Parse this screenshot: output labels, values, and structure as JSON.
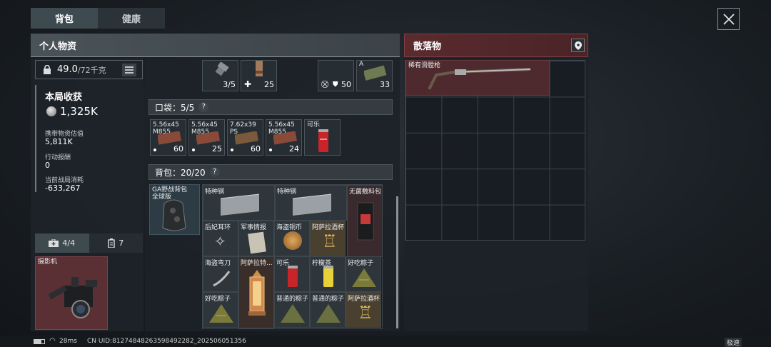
{
  "tabs": [
    {
      "label": "背包",
      "active": true
    },
    {
      "label": "健康",
      "active": false
    }
  ],
  "headers": {
    "personal": "个人物资",
    "loot": "散落物"
  },
  "weight": {
    "current": "49.0",
    "max": "/72千克"
  },
  "stats": {
    "title": "本局收获",
    "earnings": "1,325K",
    "carry_label": "携带物资估值",
    "carry_value": "5,811K",
    "action_label": "行动报酬",
    "action_value": "0",
    "cost_label": "当前战局消耗",
    "cost_value": "-633,267"
  },
  "equip_tabs": {
    "kit": "4/4",
    "ammo": "7"
  },
  "camera": {
    "label": "摄影机"
  },
  "top_items": [
    {
      "label": "",
      "count": "3/5"
    },
    {
      "label": "",
      "count": "25"
    },
    {
      "label": "",
      "count": "50"
    },
    {
      "label": "A",
      "count": "33"
    }
  ],
  "pockets": {
    "title": "口袋：5/5",
    "items": [
      {
        "label": "5.56x45 M855",
        "count": "60"
      },
      {
        "label": "5.56x45 M855",
        "count": "25"
      },
      {
        "label": "7.62x39 PS",
        "count": "60"
      },
      {
        "label": "5.56x45 M855",
        "count": "24"
      },
      {
        "label": "可乐",
        "count": ""
      }
    ]
  },
  "backpack": {
    "title": "背包：20/20",
    "pack_label": "GA野战背包 全球版",
    "items": [
      {
        "label": "特种钢"
      },
      {
        "label": "特种钢"
      },
      {
        "label": "无菌敷料包"
      },
      {
        "label": "后妃耳环"
      },
      {
        "label": "军事情报"
      },
      {
        "label": "海盗铜币"
      },
      {
        "label": "阿萨拉酒杯"
      },
      {
        "label": "海盗弯刀"
      },
      {
        "label": "阿萨拉特..."
      },
      {
        "label": "可乐"
      },
      {
        "label": "柠檬茶"
      },
      {
        "label": "好吃粽子"
      },
      {
        "label": "好吃粽子"
      },
      {
        "label": "普通的粽子"
      },
      {
        "label": "普通的粽子"
      },
      {
        "label": "阿萨拉酒杯"
      }
    ]
  },
  "loot": {
    "item_label": "稀有滑膛枪"
  },
  "status": {
    "ping": "28ms",
    "uid": "CN UID:81274848263598492282_202506051356",
    "speed": "极速"
  }
}
